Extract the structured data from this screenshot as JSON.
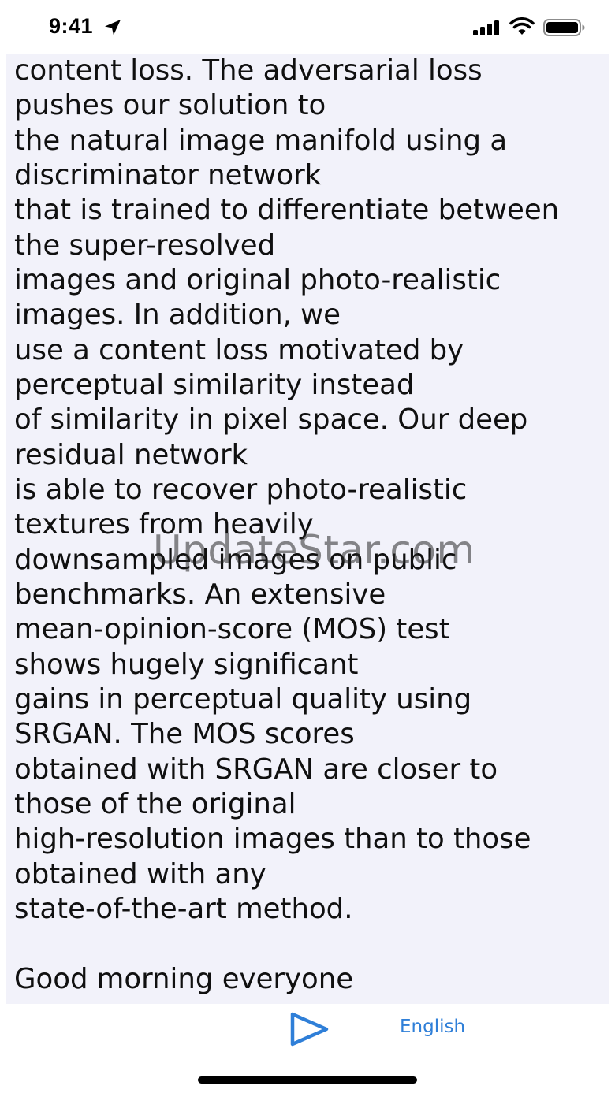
{
  "status_bar": {
    "time": "9:41",
    "icons": [
      "location-arrow-icon",
      "cellular-signal-icon",
      "wifi-icon",
      "battery-icon"
    ]
  },
  "content": {
    "lines": [
      "content loss. The adversarial loss",
      "pushes our solution to",
      "the natural image manifold using a",
      "discriminator network",
      "that is trained to differentiate between",
      "the super-resolved",
      "images and original photo-realistic",
      "images. In addition, we",
      "use a content loss motivated by",
      "perceptual similarity instead",
      "of similarity in pixel space. Our deep",
      "residual network",
      "is able to recover photo-realistic",
      "textures from heavily",
      "downsampled images on public",
      "benchmarks. An extensive",
      "mean-opinion-score (MOS) test",
      "shows hugely significant",
      "gains in perceptual quality using",
      "SRGAN. The MOS scores",
      "obtained with SRGAN are closer to",
      "those of the original",
      "high-resolution images than to those",
      "obtained with any",
      "state-of-the-art method.",
      "",
      "Good morning everyone"
    ],
    "watermark": "UpdateStar.com"
  },
  "toolbar": {
    "play_icon": "play-icon",
    "language_label": "English"
  },
  "colors": {
    "panel_background": "#f2f2fa",
    "accent": "#2f7fd8",
    "text": "#101010"
  }
}
